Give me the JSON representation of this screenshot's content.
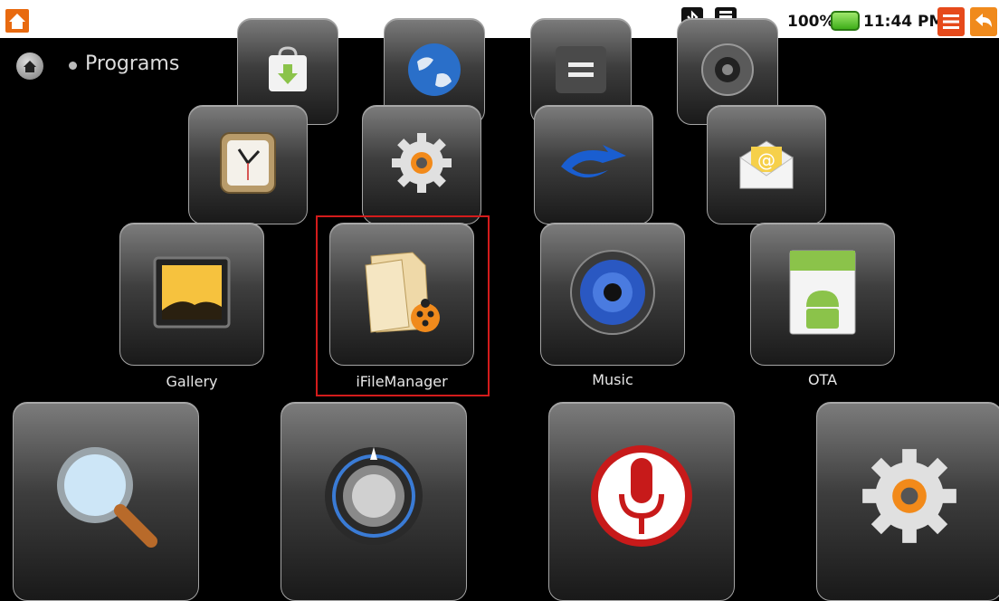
{
  "status_bar": {
    "battery": "100%",
    "time": "11:44 PM"
  },
  "breadcrumb": {
    "title": "Programs"
  },
  "apps": {
    "row3": [
      "Gallery",
      "iFileManager",
      "Music",
      "OTA"
    ]
  },
  "icons": {
    "row1": [
      "market-icon",
      "browser-globe-icon",
      "calculator-icon",
      "camera-icon"
    ],
    "row2": [
      "clock-icon",
      "settings-gear-icon",
      "sync-icon",
      "email-icon"
    ],
    "row3": [
      "gallery-icon",
      "file-manager-icon",
      "music-speaker-icon",
      "android-ota-icon"
    ],
    "row4": [
      "search-icon",
      "volume-knob-icon",
      "voice-microphone-icon",
      "settings-gear-icon"
    ]
  },
  "colors": {
    "selection": "#d31b1b",
    "tile_border": "#a5a5a5"
  }
}
